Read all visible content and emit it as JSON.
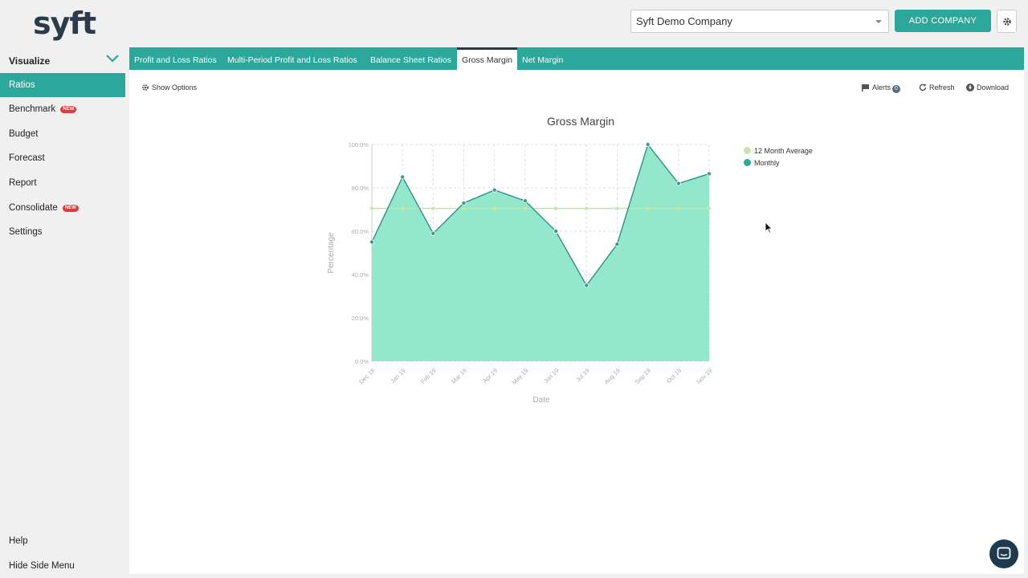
{
  "header": {
    "logo_text": "syft",
    "company_selected": "Syft Demo Company",
    "add_company_label": "ADD COMPANY"
  },
  "sidebar": {
    "heading": "Visualize",
    "items": [
      {
        "label": "Ratios",
        "active": true,
        "badge": ""
      },
      {
        "label": "Benchmark",
        "active": false,
        "badge": "NEW"
      },
      {
        "label": "Budget",
        "active": false,
        "badge": ""
      },
      {
        "label": "Forecast",
        "active": false,
        "badge": ""
      },
      {
        "label": "Report",
        "active": false,
        "badge": ""
      },
      {
        "label": "Consolidate",
        "active": false,
        "badge": "NEW"
      },
      {
        "label": "Settings",
        "active": false,
        "badge": ""
      }
    ],
    "help_label": "Help",
    "hide_label": "Hide Side Menu"
  },
  "tabs": [
    {
      "label": "Profit and Loss Ratios",
      "active": false
    },
    {
      "label": "Multi-Period Profit and Loss Ratios",
      "active": false
    },
    {
      "label": "Balance Sheet Ratios",
      "active": false
    },
    {
      "label": "Gross Margin",
      "active": true
    },
    {
      "label": "Net Margin",
      "active": false
    }
  ],
  "toolbar": {
    "show_options": "Show Options",
    "alerts": "Alerts",
    "alerts_count": "0",
    "refresh": "Refresh",
    "download": "Download"
  },
  "colors": {
    "accent": "#2ca79c",
    "dark": "#1d3b4e",
    "area_fill": "#8de6c8",
    "line": "#2f9186",
    "average": "#c5e6a6"
  },
  "chart_data": {
    "type": "area",
    "title": "Gross Margin",
    "xlabel": "Date",
    "ylabel": "Percentage",
    "categories": [
      "Dec 18",
      "Jan 19",
      "Feb 19",
      "Mar 19",
      "Apr 19",
      "May 19",
      "Jun 19",
      "Jul 19",
      "Aug 19",
      "Sep 19",
      "Oct 19",
      "Nov 19"
    ],
    "ylim": [
      0,
      100
    ],
    "yticks": [
      "0.0%",
      "20.0%",
      "40.0%",
      "60.0%",
      "80.0%",
      "100.0%"
    ],
    "series": [
      {
        "name": "12 Month Average",
        "values": [
          70.5,
          70.5,
          70.5,
          70.5,
          70.5,
          70.5,
          70.5,
          70.5,
          70.5,
          70.5,
          70.5,
          70.5
        ]
      },
      {
        "name": "Monthly",
        "values": [
          55,
          85,
          59,
          73,
          79,
          74,
          60,
          35,
          54,
          100,
          82,
          86.5
        ]
      }
    ],
    "legend_position": "right"
  }
}
